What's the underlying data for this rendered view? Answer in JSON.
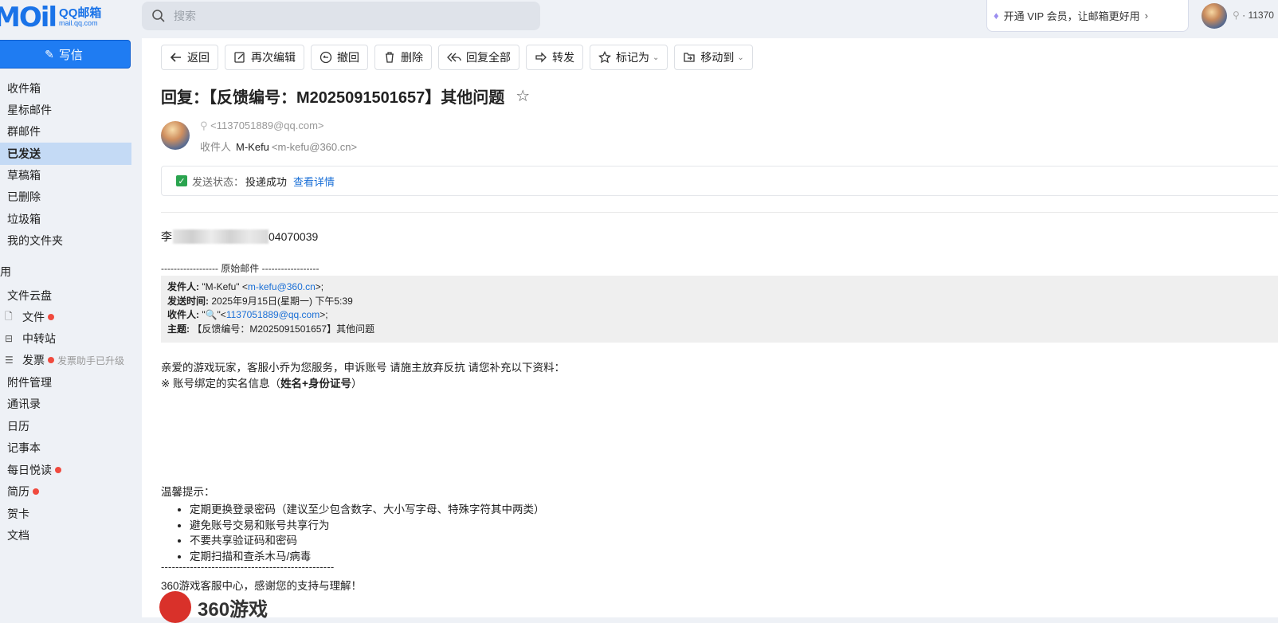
{
  "app": {
    "logo_big": "MOil",
    "logo_cn": "QQ邮箱",
    "logo_url": "mail.qq.com",
    "search_placeholder": "搜索",
    "vip_text": "开通 VIP 会员，让邮箱更好用",
    "user_id": "· 11370"
  },
  "sidebar": {
    "write_label": "写信",
    "items": [
      {
        "label": "收件箱"
      },
      {
        "label": "星标邮件"
      },
      {
        "label": "群邮件"
      },
      {
        "label": "已发送"
      },
      {
        "label": "草稿箱"
      },
      {
        "label": "已删除"
      },
      {
        "label": "垃圾箱"
      },
      {
        "label": "我的文件夹"
      }
    ],
    "section_label": "用",
    "apps": [
      {
        "label": "文件云盘"
      },
      {
        "label": "文件"
      },
      {
        "label": "中转站"
      },
      {
        "label": "发票",
        "sub": "发票助手已升级"
      },
      {
        "label": "附件管理"
      },
      {
        "label": "通讯录"
      },
      {
        "label": "日历"
      },
      {
        "label": "记事本"
      },
      {
        "label": "每日悦读"
      },
      {
        "label": "简历"
      },
      {
        "label": "贺卡"
      },
      {
        "label": "文档"
      }
    ]
  },
  "toolbar": {
    "back": "返回",
    "reedit": "再次编辑",
    "recall": "撤回",
    "delete": "删除",
    "reply_all": "回复全部",
    "forward": "转发",
    "mark_as": "标记为",
    "move_to": "移动到"
  },
  "mail": {
    "subject": "回复：【反馈编号：M2025091501657】其他问题",
    "sender": "<1137051889@qq.com>",
    "recipient_label": "收件人",
    "recipient_name": "M-Kefu",
    "recipient_email": "<m-kefu@360.cn>",
    "status_label": "发送状态：",
    "status_value": "投递成功",
    "status_link": "查看详情",
    "greeting_start": "李",
    "greeting_end": "04070039",
    "original_sep": "------------------ 原始邮件 ------------------",
    "quote": {
      "from_label": "发件人:",
      "from_name": "\"M-Kefu\" <",
      "from_email": "m-kefu@360.cn",
      "from_end": ">;",
      "time_label": "发送时间:",
      "time_value": "2025年9月15日(星期一) 下午5:39",
      "to_label": "收件人:",
      "to_name": "\"🔍\"<",
      "to_email": "1137051889@qq.com",
      "to_end": ">;",
      "subject_label": "主题:",
      "subject_value": "【反馈编号：M2025091501657】其他问题"
    },
    "body_line1": "亲爱的游戏玩家，客服小乔为您服务，申诉账号 请施主放弃反抗 请您补充以下资料：",
    "body_line2_a": "※ 账号绑定的实名信息（",
    "body_line2_b": "姓名+身份证号",
    "body_line2_c": "）",
    "tips_title": "温馨提示：",
    "tips": [
      "定期更换登录密码（建议至少包含数字、大小写字母、特殊字符其中两类）",
      "避免账号交易和账号共享行为",
      "不要共享验证码和密码",
      "定期扫描和查杀木马/病毒"
    ],
    "dashes": "------------------------------------------------",
    "signature": "360游戏客服中心，感谢您的支持与理解！",
    "brand_text": "360游戏"
  }
}
